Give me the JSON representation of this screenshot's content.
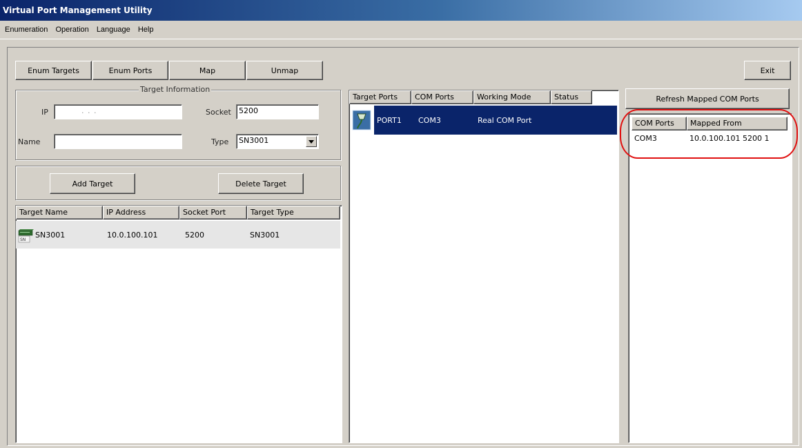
{
  "window": {
    "title": "Virtual Port Management Utility"
  },
  "menu": [
    "Enumeration",
    "Operation",
    "Language",
    "Help"
  ],
  "toolbar": {
    "enum_targets": "Enum Targets",
    "enum_ports": "Enum Ports",
    "map": "Map",
    "unmap": "Unmap",
    "exit": "Exit"
  },
  "target_info": {
    "title": "Target Information",
    "ip_label": "IP",
    "ip_value": ".       .       .",
    "socket_label": "Socket",
    "socket_value": "5200",
    "name_label": "Name",
    "name_value": "",
    "type_label": "Type",
    "type_value": "SN3001"
  },
  "target_buttons": {
    "add": "Add Target",
    "delete": "Delete Target"
  },
  "targets_table": {
    "columns": [
      "Target Name",
      "IP Address",
      "Socket Port",
      "Target Type"
    ],
    "rows": [
      {
        "name": "SN3001",
        "ip": "10.0.100.101",
        "socket": "5200",
        "type": "SN3001",
        "icon": "device-icon",
        "icon_text": "SN"
      }
    ]
  },
  "ports_table": {
    "columns": [
      "Target Ports",
      "COM Ports",
      "Working Mode",
      "Status"
    ],
    "rows": [
      {
        "port": "PORT1",
        "com": "COM3",
        "mode": "Real COM Port",
        "status": "",
        "icon": "port-connector-icon",
        "selected": true
      }
    ]
  },
  "mapped": {
    "refresh_button": "Refresh Mapped COM Ports",
    "columns": [
      "COM Ports",
      "Mapped From"
    ],
    "rows": [
      {
        "com": "COM3",
        "from": "10.0.100.101 5200 1"
      }
    ],
    "annotation_color": "#e01010"
  },
  "colors": {
    "selection": "#0a246a",
    "face": "#d4d0c8",
    "title_gradient_start": "#0a246a",
    "title_gradient_end": "#a6caf0"
  }
}
